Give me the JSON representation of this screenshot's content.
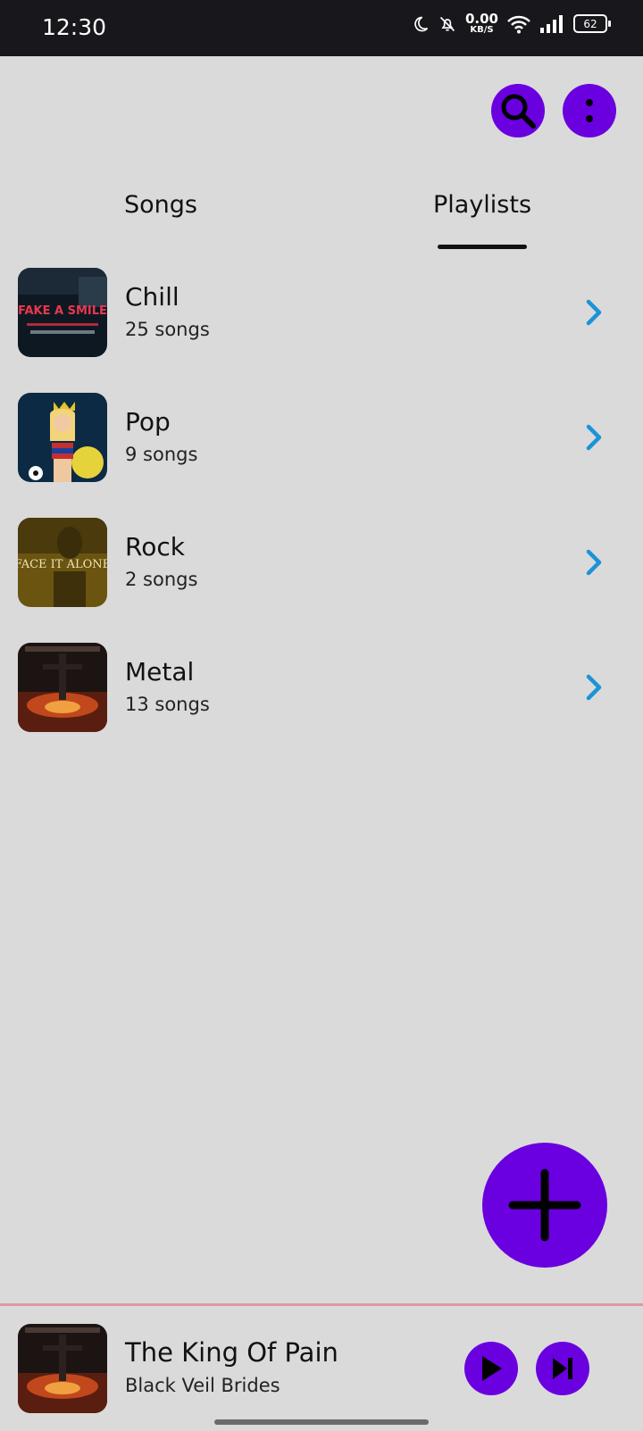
{
  "status": {
    "time": "12:30",
    "net_speed": "0.00",
    "net_unit": "KB/S",
    "battery": "62"
  },
  "header": {
    "search_icon": "search-icon",
    "menu_icon": "more-vert-icon"
  },
  "tabs": [
    {
      "label": "Songs",
      "selected": false
    },
    {
      "label": "Playlists",
      "selected": true
    }
  ],
  "playlists": [
    {
      "name": "Chill",
      "count": "25 songs",
      "cover_text": "FAKE A SMILE"
    },
    {
      "name": "Pop",
      "count": "9 songs"
    },
    {
      "name": "Rock",
      "count": "2 songs",
      "cover_text": "FACE IT ALONE"
    },
    {
      "name": "Metal",
      "count": "13 songs"
    }
  ],
  "fab": {
    "icon": "plus-icon"
  },
  "now_playing": {
    "title": "The King Of Pain",
    "artist": "Black Veil Brides"
  },
  "colors": {
    "accent": "#6a00e0",
    "chevron": "#1a94d6",
    "background": "#dadadb",
    "statusbar": "#18171c",
    "player_border": "#dc9b9f"
  }
}
